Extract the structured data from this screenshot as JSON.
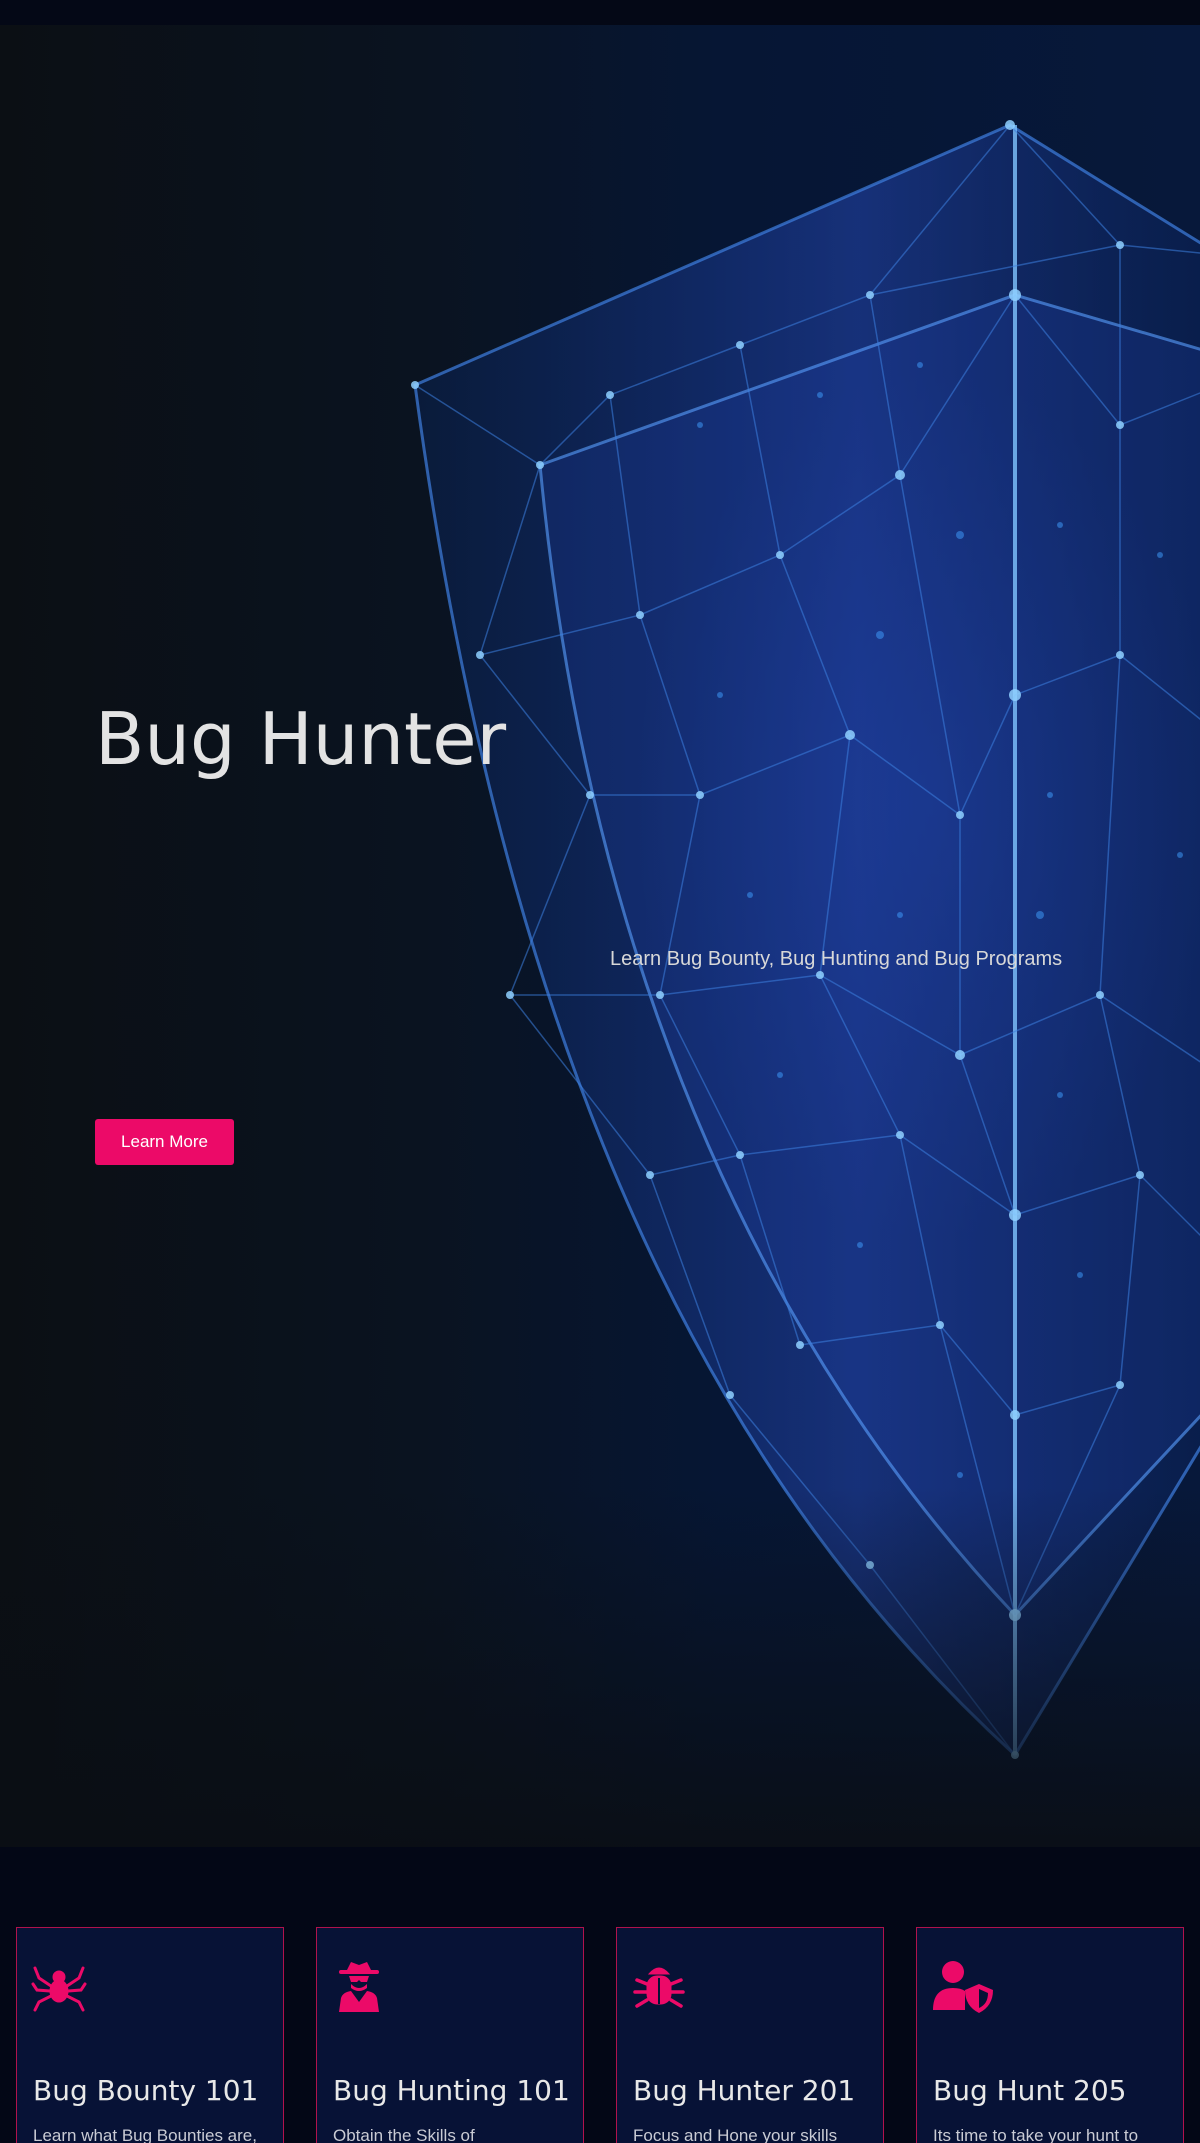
{
  "hero": {
    "title": "Bug Hunter",
    "subtitle": "Learn Bug Bounty, Bug Hunting and Bug Programs",
    "cta_label": "Learn More",
    "background_image": "glowing-polygon-shield-graphic"
  },
  "cards": [
    {
      "icon": "spider-icon",
      "title": "Bug Bounty 101",
      "text": "Learn what Bug Bounties are,"
    },
    {
      "icon": "spy-icon",
      "title": "Bug Hunting 101",
      "text": "Obtain the Skills of"
    },
    {
      "icon": "bug-icon",
      "title": "Bug Hunter 201",
      "text": "Focus and Hone your skills"
    },
    {
      "icon": "user-shield-icon",
      "title": "Bug Hunt 205",
      "text": "Its time to take your hunt to"
    }
  ],
  "colors": {
    "accent": "#ec0a68",
    "card_background": "#071236",
    "card_border": "#b0124c",
    "page_background": "#030716"
  }
}
